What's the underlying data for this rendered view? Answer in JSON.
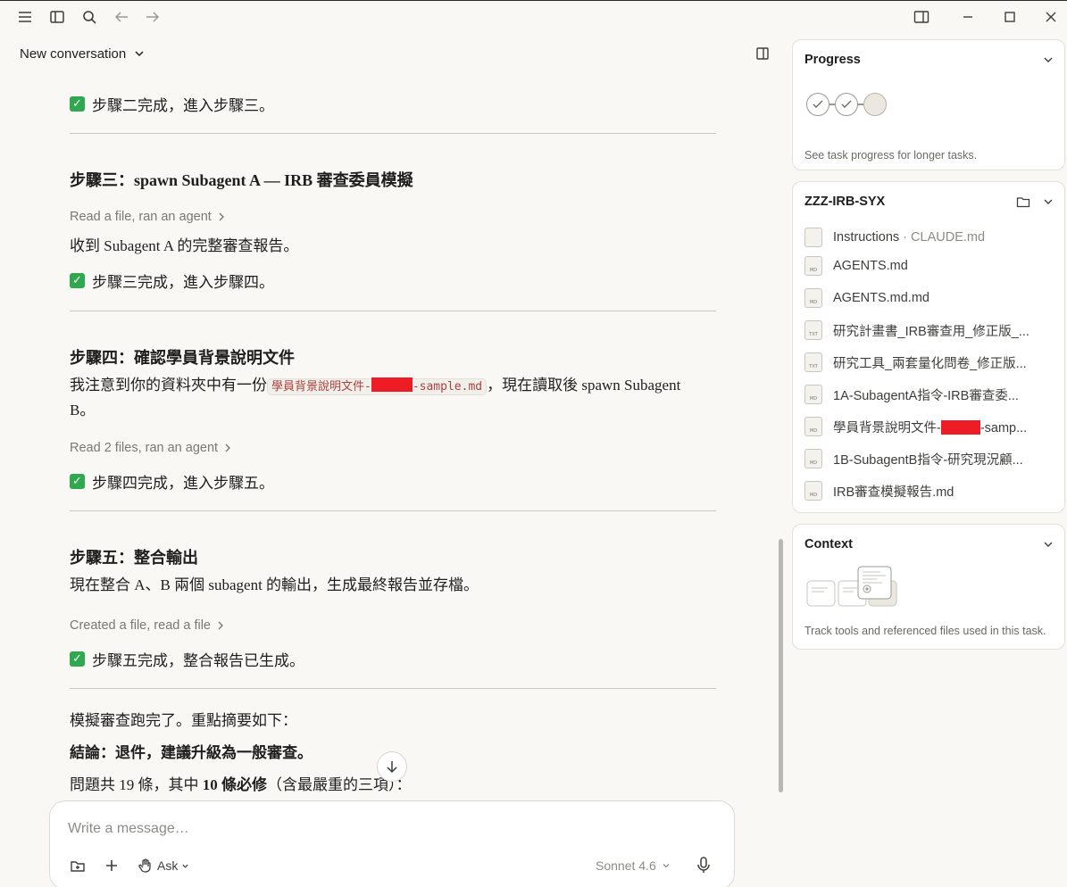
{
  "conversation": {
    "title": "New conversation"
  },
  "chat": {
    "step2_done": "步驟二完成，進入步驟三。",
    "step3_heading": "步驟三：spawn Subagent A — IRB 審查委員模擬",
    "step3_activity": "Read a file, ran an agent",
    "step3_body": "收到 Subagent A 的完整審查報告。",
    "step3_done": "步驟三完成，進入步驟四。",
    "step4_heading": "步驟四：確認學員背景說明文件",
    "step4_body_a": "我注意到你的資料夾中有一份",
    "step4_code_a": "學員背景說明文件-",
    "step4_code_b": "-sample.md",
    "step4_body_b": "，現在讀取後 spawn Subagent B。",
    "step4_activity": "Read 2 files, ran an agent",
    "step4_done": "步驟四完成，進入步驟五。",
    "step5_heading": "步驟五：整合輸出",
    "step5_body": "現在整合 A、B 兩個 subagent 的輸出，生成最終報告並存檔。",
    "step5_activity": "Created a file, read a file",
    "step5_done": "步驟五完成，整合報告已生成。",
    "summary_intro": "模擬審查跑完了。重點摘要如下：",
    "conclusion": "結論：退件，建議升級為一般審查。",
    "issues_a": "問題共 19 條，其中 ",
    "issues_b": "10 條必修",
    "issues_c": "（含最嚴重的三項）："
  },
  "composer": {
    "placeholder": "Write a message…",
    "mode": "Ask",
    "model": "Sonnet 4.6"
  },
  "progress": {
    "title": "Progress",
    "note": "See task progress for longer tasks."
  },
  "project": {
    "title": "ZZZ-IRB-SYX",
    "files": [
      {
        "icon": "",
        "name": "Instructions",
        "extra": " · CLAUDE.md"
      },
      {
        "icon": "MD",
        "name": "AGENTS.md"
      },
      {
        "icon": "MD",
        "name": "AGENTS.md.md"
      },
      {
        "icon": "TXT",
        "name": "研究計畫書_IRB審查用_修正版_..."
      },
      {
        "icon": "TXT",
        "name": "研究工具_兩套量化問卷_修正版..."
      },
      {
        "icon": "MD",
        "name": "1A-SubagentA指令-IRB審查委..."
      },
      {
        "icon": "MD",
        "name": "學員背景說明文件-",
        "tail": "-samp..."
      },
      {
        "icon": "MD",
        "name": "1B-SubagentB指令-研究現況顧..."
      },
      {
        "icon": "MD",
        "name": "IRB審查模擬報告.md"
      }
    ]
  },
  "context": {
    "title": "Context",
    "note": "Track tools and referenced files used in this task."
  }
}
